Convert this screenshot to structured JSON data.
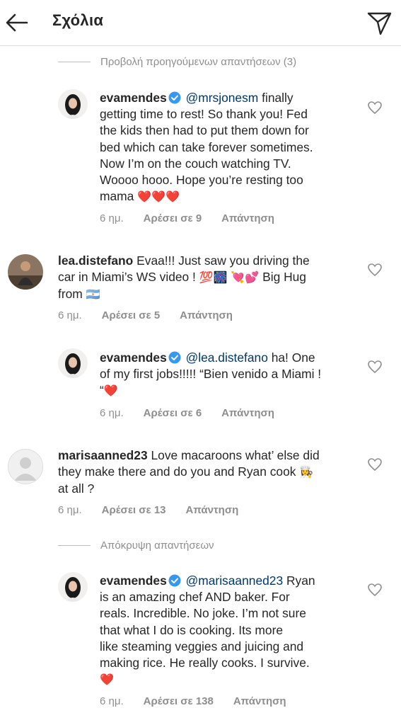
{
  "header": {
    "title": "Σχόλια"
  },
  "toggles": {
    "view_previous": "Προβολή προηγούμενων απαντήσεων (3)",
    "hide_replies": "Απόκρυψη απαντήσεων"
  },
  "comments": [
    {
      "username": "evamendes",
      "mention": "@mrsjonesm",
      "text_lines": [
        "finally",
        "getting time to rest! So thank you! Fed",
        "the kids then had to put them down for",
        "bed which can take forever sometimes.",
        "Now I’m on the couch watching TV.",
        "Woooo hooo. Hope you’re resting too",
        "mama"
      ],
      "emoji": "❤️❤️❤️",
      "time": "6 ημ.",
      "likes": "Αρέσει σε 9",
      "reply": "Απάντηση"
    },
    {
      "username": "lea.distefano",
      "text_lines": [
        "Evaa!!! Just saw you driving the",
        "car in Miami’s WS video !",
        "Big Hug",
        "from"
      ],
      "emoji_a": "💯🎆",
      "emoji_b": "💘💕",
      "emoji_c": "🇦🇷",
      "time": "6 ημ.",
      "likes": "Αρέσει σε 5",
      "reply": "Απάντηση"
    },
    {
      "username": "evamendes",
      "mention": "@lea.distefano",
      "text_lines": [
        "ha! One",
        "of my first jobs!!!!! “Bien venido a Miami !",
        "“"
      ],
      "emoji": "❤️",
      "time": "6 ημ.",
      "likes": "Αρέσει σε 6",
      "reply": "Απάντηση"
    },
    {
      "username": "marisaanned23",
      "text_lines": [
        "Love macaroons what’ else did",
        "they make there and do you and Ryan cook",
        "at all ?"
      ],
      "emoji": "👩‍🍳",
      "time": "6 ημ.",
      "likes": "Αρέσει σε 13",
      "reply": "Απάντηση"
    },
    {
      "username": "evamendes",
      "mention": "@marisaanned23",
      "text_lines": [
        "Ryan",
        "is an amazing chef AND baker. For",
        "reals. Incredible.  No joke. I’m not sure",
        "that what I do is cooking. Its more",
        "like steaming veggies and juicing and",
        "making rice. He really cooks. I survive."
      ],
      "emoji": "❤️",
      "time": "6 ημ.",
      "likes": "Αρέσει σε 138",
      "reply": "Απάντηση"
    }
  ]
}
